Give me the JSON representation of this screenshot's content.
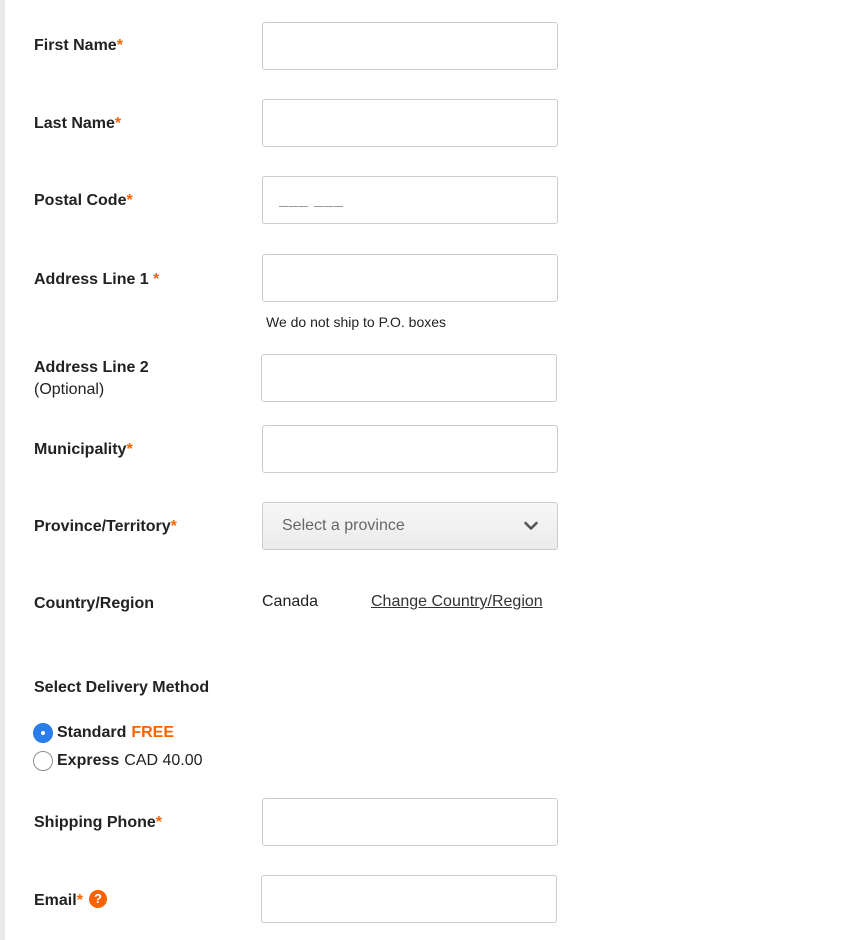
{
  "form": {
    "first_name_label": "First Name",
    "last_name_label": "Last Name",
    "postal_code_label": "Postal Code",
    "postal_code_placeholder": "___ ___",
    "address1_label": "Address Line 1 ",
    "address1_hint": "We do not ship to P.O. boxes",
    "address2_label": "Address Line 2",
    "address2_sub": "(Optional)",
    "municipality_label": "Municipality",
    "province_label": "Province/Territory",
    "province_placeholder": "Select a province",
    "country_label": "Country/Region",
    "country_value": "Canada",
    "change_country_link": "Change Country/Region",
    "shipping_phone_label": "Shipping Phone",
    "email_label": "Email",
    "required_mark": "*",
    "help_glyph": "?"
  },
  "delivery": {
    "title": "Select Delivery Method",
    "options": [
      {
        "name": "Standard",
        "price": "FREE",
        "selected": true
      },
      {
        "name": "Express",
        "price": "CAD 40.00",
        "selected": false
      }
    ]
  },
  "colors": {
    "accent": "#f96302",
    "radio_selected": "#2b7de9",
    "border": "#cccccc"
  },
  "icons": {
    "province_dropdown": "chevron-down-icon",
    "email_help": "help-icon",
    "standard_radio": "radio-selected-icon",
    "express_radio": "radio-unselected-icon"
  }
}
